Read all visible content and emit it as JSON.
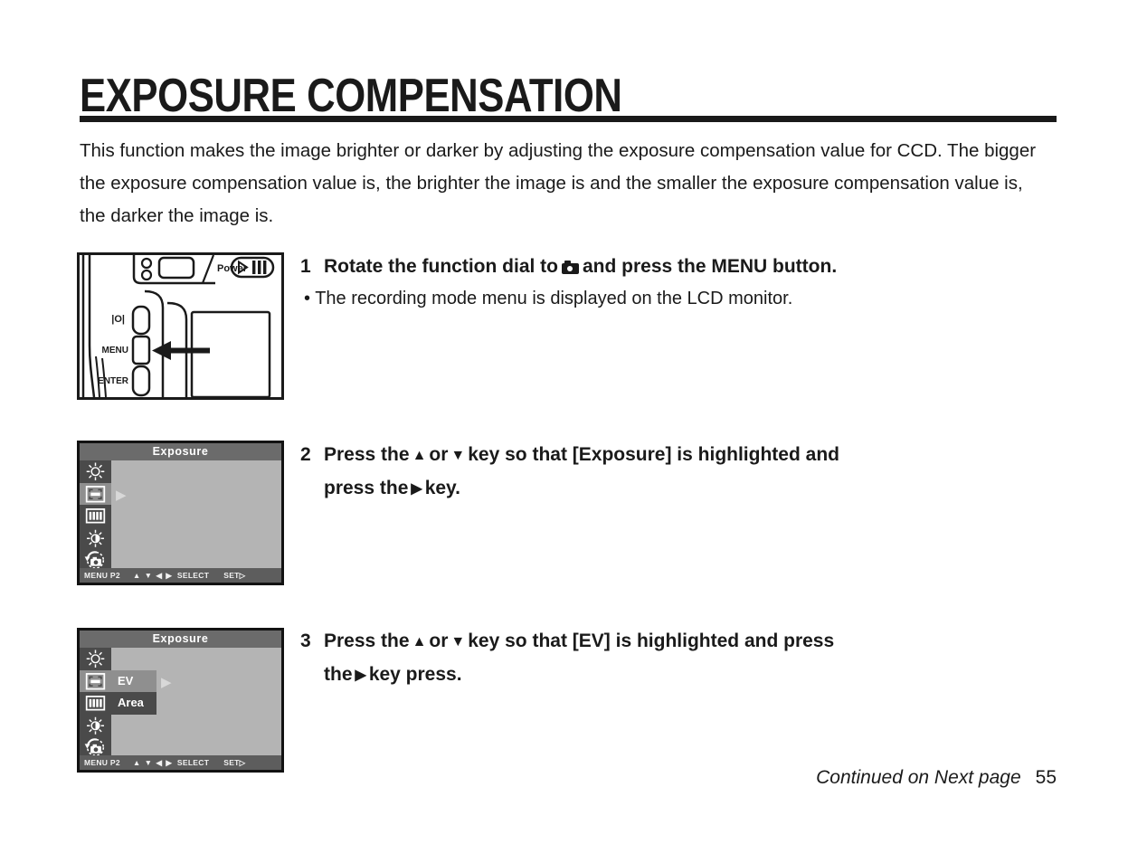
{
  "page": {
    "title": "EXPOSURE COMPENSATION",
    "intro": "This function makes the image brighter or darker  by adjusting the exposure compensation value for CCD. The bigger the exposure compensation value is, the brighter the image is and the smaller the exposure compensation value is, the darker the image is.",
    "footer_note": "Continued on Next page",
    "page_number": "55"
  },
  "steps": [
    {
      "number": "1",
      "head_before_icon": "Rotate the function dial to",
      "icon": "camera-icon",
      "head_after_icon": "and press the MENU button.",
      "bullet": "•  The recording mode menu is displayed on the LCD monitor."
    },
    {
      "number": "2",
      "line1_a": "Press the",
      "key_up": "▲",
      "line1_b": "or",
      "key_down": "▼",
      "line1_c": "key so that [Exposure] is highlighted and",
      "line2_a": "press the",
      "key_right": "▶",
      "line2_b": "key."
    },
    {
      "number": "3",
      "line1_a": "Press the",
      "key_up": "▲",
      "line1_b": "or",
      "key_down": "▼",
      "line1_c": "key so that [EV] is highlighted and press",
      "line2_a": "the",
      "key_right": "▶",
      "line2_b": "key press."
    }
  ],
  "camera_figure": {
    "power_label": "Power",
    "display_button_label": "|O|",
    "menu_button_label": "MENU",
    "enter_button_label": "ENTER"
  },
  "lcd_screen_1": {
    "title": "Exposure",
    "icons": [
      "white-balance-sun-icon",
      "exposure-frame-icon",
      "bars-icon",
      "brightness-icon",
      "camera-reset-icon"
    ],
    "selected_icon_index": 1,
    "cursor": "▶",
    "status": {
      "menu": "MENU P2",
      "keys": "▲ ▼ ◀ ▶",
      "select": "SELECT",
      "set": "SET",
      "set_arrow": "▷"
    }
  },
  "lcd_screen_2": {
    "title": "Exposure",
    "icons": [
      "white-balance-sun-icon",
      "exposure-frame-icon",
      "bars-icon",
      "brightness-icon",
      "camera-reset-icon"
    ],
    "selected_icon_index": 1,
    "options": [
      {
        "label": "EV",
        "highlighted": true
      },
      {
        "label": "Area",
        "highlighted": false
      }
    ],
    "cursor": "▶",
    "status": {
      "menu": "MENU P2",
      "keys": "▲ ▼ ◀ ▶",
      "select": "SELECT",
      "set": "SET",
      "set_arrow": "▷"
    }
  },
  "colors": {
    "ink": "#1a1a1a",
    "lcd_panel": "#b4b4b4",
    "lcd_title_bar": "#6b6b6b",
    "lcd_icon_col": "#4a4a4a",
    "lcd_selected": "#8f8f8f",
    "lcd_status_bar": "#5d5d5d"
  }
}
